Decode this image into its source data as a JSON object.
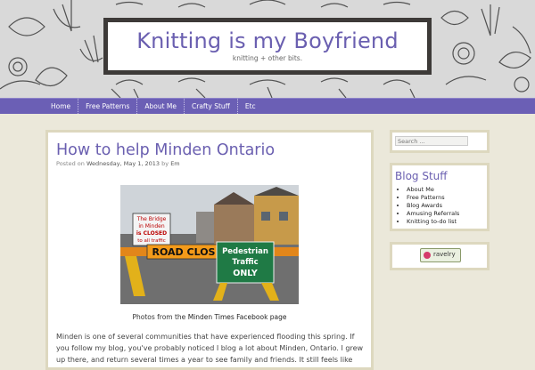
{
  "site": {
    "title": "Knitting is my Boyfriend",
    "tagline": "knitting + other bits."
  },
  "nav": {
    "items": [
      "Home",
      "Free Patterns",
      "About Me",
      "Crafty Stuff",
      "Etc"
    ]
  },
  "post": {
    "title": "How to help Minden Ontario",
    "posted_on": "Posted on",
    "date": "Wednesday, May 1, 2013",
    "by": "by",
    "author": "Em",
    "photo_signs": {
      "bridge_line1": "The Bridge",
      "bridge_line2": "in Minden",
      "bridge_line3": "is CLOSED",
      "bridge_line4": "to all traffic",
      "road_closed": "ROAD CLOS",
      "ped_line1": "Pedestrian",
      "ped_line2": "Traffic",
      "ped_line3": "ONLY"
    },
    "caption_prefix": "Photos from the",
    "caption_link": "Minden Times Facebook page",
    "body": "Minden is one of several communities that have experienced flooding this spring. If you follow my blog, you've probably noticed I blog a lot about Minden, Ontario. I grew up there, and return several times a year to see family and friends. It still feels like home."
  },
  "sidebar": {
    "search_placeholder": "Search ...",
    "blog_stuff": {
      "title": "Blog Stuff",
      "links": [
        "About Me",
        "Free Patterns",
        "Blog Awards",
        "Amusing Referrals",
        "Knitting to-do list"
      ]
    },
    "ravelry_label": "ravelry"
  },
  "colors": {
    "accent": "#6b5fb5",
    "title": "#6a5fb0",
    "background": "#ebe8da",
    "border": "#ddd8bf"
  }
}
